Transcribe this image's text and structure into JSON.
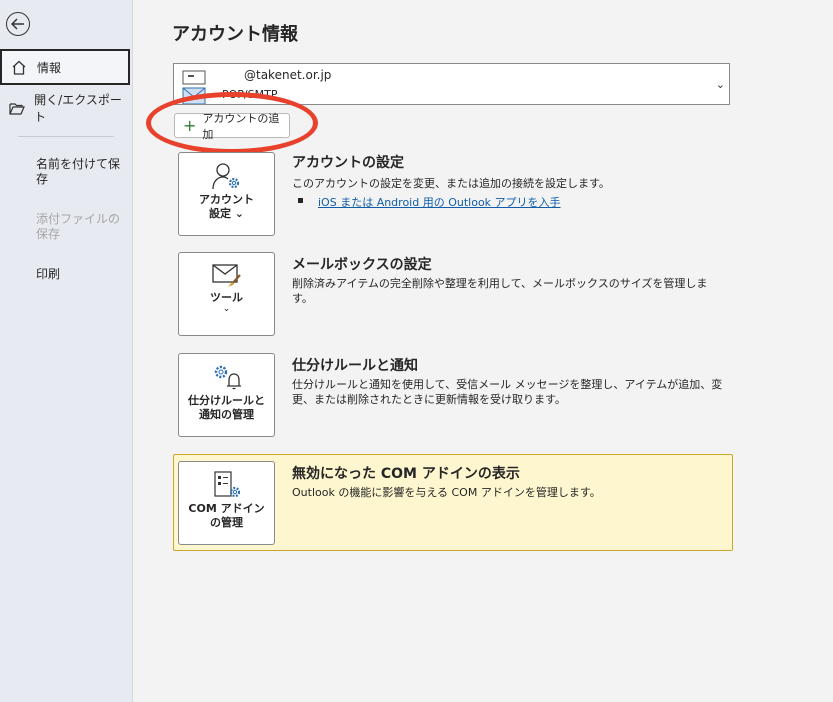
{
  "sidebar": {
    "back_icon": "back-arrow-icon",
    "items": [
      {
        "label": "情報",
        "icon": "home-icon",
        "selected": true
      },
      {
        "label": "開く/エクスポート",
        "icon": "folder-open-icon"
      },
      {
        "label": "名前を付けて保存"
      },
      {
        "label": "添付ファイルの保存",
        "disabled": true
      },
      {
        "label": "印刷"
      }
    ]
  },
  "main": {
    "title": "アカウント情報",
    "account": {
      "email": "@takenet.or.jp",
      "type": "POP/SMTP",
      "chevron": "⌄"
    },
    "add_account_label": "アカウントの追加",
    "sections": [
      {
        "tile_label": "アカウント設定",
        "tile_label_lines": [
          "アカウント",
          "設定 ⌄"
        ],
        "title": "アカウントの設定",
        "description": "このアカウントの設定を変更、または追加の接続を設定します。",
        "link": "iOS または Android 用の Outlook アプリを入手"
      },
      {
        "tile_label_lines": [
          "ツール",
          "⌄"
        ],
        "title": "メールボックスの設定",
        "description": "削除済みアイテムの完全削除や整理を利用して、メールボックスのサイズを管理します。"
      },
      {
        "tile_label_lines": [
          "仕分けルールと",
          "通知の管理"
        ],
        "title": "仕分けルールと通知",
        "description": "仕分けルールと通知を使用して、受信メール メッセージを整理し、アイテムが追加、変更、または削除されたときに更新情報を受け取ります。"
      },
      {
        "tile_label_lines": [
          "COM アドイン",
          "の管理"
        ],
        "title": "無効になった COM アドインの表示",
        "description": "Outlook の機能に影響を与える COM アドインを管理します。"
      }
    ]
  },
  "colors": {
    "sidebar_bg": "#e7eaf0",
    "main_bg": "#f3f3f3",
    "link": "#0f5da8",
    "highlight": "#e8412c",
    "warning_bg": "#fdf6cf",
    "warning_border": "#c8a72c",
    "icon_blue": "#2f6fb0"
  }
}
